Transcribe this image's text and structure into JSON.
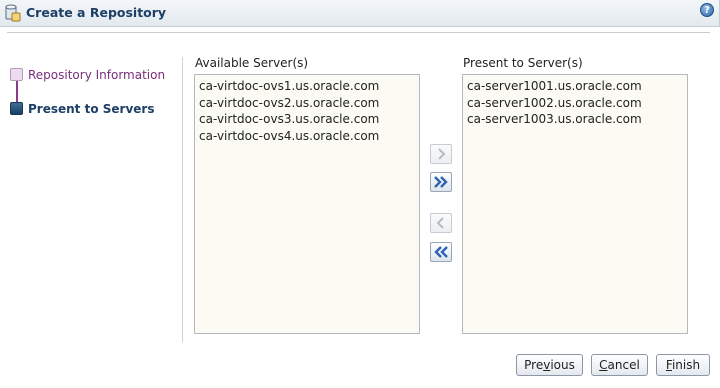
{
  "dialog": {
    "title": "Create a Repository",
    "help_icon": "question-mark-icon",
    "help_glyph": "?"
  },
  "train": {
    "steps": [
      {
        "label": "Repository Information",
        "state": "visited"
      },
      {
        "label": "Present to Servers",
        "state": "current"
      }
    ]
  },
  "available": {
    "caption": "Available Server(s)",
    "items": [
      "ca-virtdoc-ovs1.us.oracle.com",
      "ca-virtdoc-ovs2.us.oracle.com",
      "ca-virtdoc-ovs3.us.oracle.com",
      "ca-virtdoc-ovs4.us.oracle.com"
    ]
  },
  "present": {
    "caption": "Present to Server(s)",
    "items": [
      "ca-server1001.us.oracle.com",
      "ca-server1002.us.oracle.com",
      "ca-server1003.us.oracle.com"
    ]
  },
  "shuttle": {
    "move": {
      "icon": "chevron-right-icon",
      "enabled": false
    },
    "move_all": {
      "icon": "double-chevron-right-icon",
      "enabled": true
    },
    "remove": {
      "icon": "chevron-left-icon",
      "enabled": false
    },
    "remove_all": {
      "icon": "double-chevron-left-icon",
      "enabled": true
    }
  },
  "footer": {
    "previous": {
      "pre": "Pre",
      "accel": "v",
      "post": "ious"
    },
    "cancel": {
      "pre": "",
      "accel": "C",
      "post": "ancel"
    },
    "finish": {
      "pre": "",
      "accel": "F",
      "post": "inish"
    }
  },
  "colors": {
    "title_text": "#1d3f66",
    "visited_step": "#7a2f7a",
    "current_step": "#1d3f66",
    "listbox_bg": "#fbfbf4",
    "arrow_blue": "#2f62b0"
  }
}
